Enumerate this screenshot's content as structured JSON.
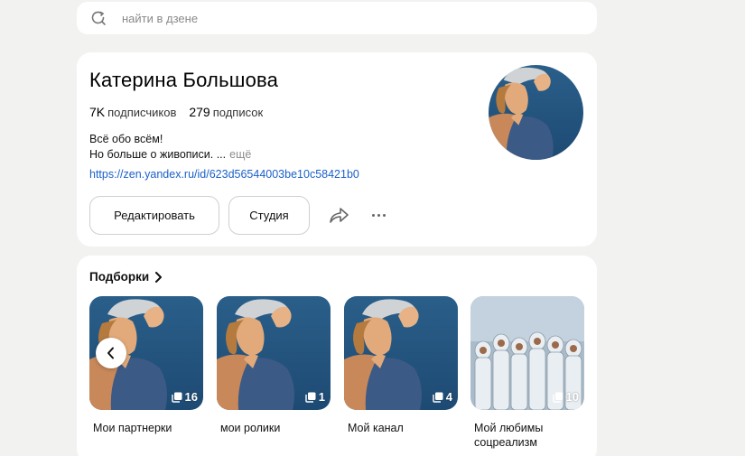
{
  "search": {
    "placeholder": "найти в дзене"
  },
  "profile": {
    "name": "Катерина Большова",
    "subscribers_count": "7K",
    "subscribers_label": "подписчиков",
    "subscriptions_count": "279",
    "subscriptions_label": "подписок",
    "bio_line1": "Всё обо всём!",
    "bio_line2": "Но больше о живописи. ...",
    "bio_more": "ещё",
    "url": "https://zen.yandex.ru/id/623d56544003be10c58421b0",
    "edit_label": "Редактировать",
    "studio_label": "Студия"
  },
  "collections": {
    "title": "Подборки",
    "items": [
      {
        "caption": "Мои партнерки",
        "count": "16"
      },
      {
        "caption": "мои ролики",
        "count": "1"
      },
      {
        "caption": "Мой канал",
        "count": "4"
      },
      {
        "caption": "Мой любимы соцреализм",
        "count": "10"
      }
    ]
  },
  "icons": {
    "search": "search-icon",
    "share": "share-icon",
    "more": "more-dots-icon",
    "chevron": "chevron-right-icon",
    "prev": "chevron-left-icon",
    "collection_count": "stack-icon"
  },
  "colors": {
    "link": "#1b60c9",
    "page_bg": "#f2f2f0"
  }
}
